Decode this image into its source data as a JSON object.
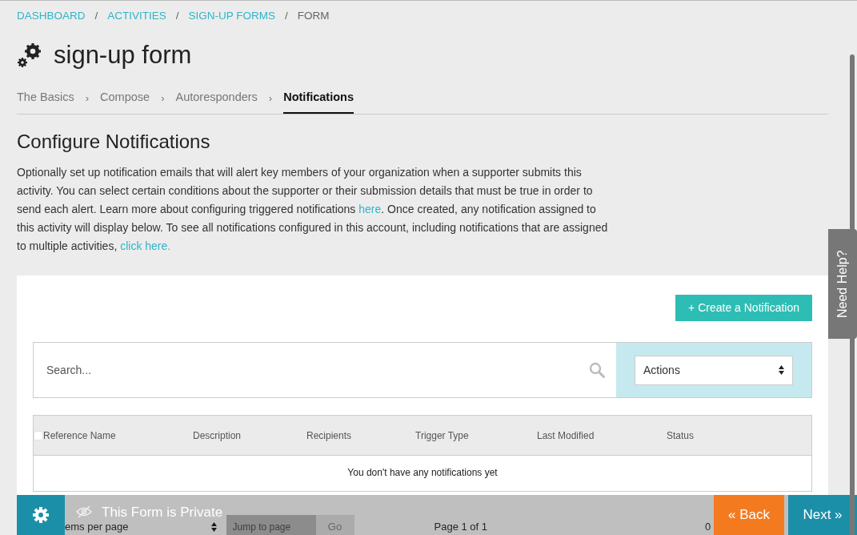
{
  "breadcrumbs": [
    {
      "label": "DASHBOARD",
      "kind": "link"
    },
    {
      "label": "ACTIVITIES",
      "kind": "link"
    },
    {
      "label": "SIGN-UP FORMS",
      "kind": "link"
    },
    {
      "label": "FORM",
      "kind": "current"
    }
  ],
  "breadcrumb_separators": [
    "/",
    "/",
    "/"
  ],
  "title": "sign-up form",
  "step_separators": [
    "›",
    "›",
    "›"
  ],
  "steps": [
    {
      "label": "The Basics",
      "selected": false
    },
    {
      "label": "Compose",
      "selected": false
    },
    {
      "label": "Autoresponders",
      "selected": false
    },
    {
      "label": "Notifications",
      "selected": true
    }
  ],
  "section_title": "Configure Notifications",
  "description": [
    {
      "kind": "text",
      "text": "Optionally set up notification emails that will alert key members of your organization when a supporter submits this activity. You can select certain conditions about the supporter or their submission details that must be true in order to send each alert. Learn more about configuring triggered notifications "
    },
    {
      "kind": "link",
      "text": "here"
    },
    {
      "kind": "text",
      "text": ". Once created, any notification assigned to this activity will display below. To see all notifications configured in this account, including notifications that are assigned to multiple activities, "
    },
    {
      "kind": "link",
      "text": "click here."
    }
  ],
  "create_button": "+ Create a Notification",
  "search": {
    "placeholder": "Search..."
  },
  "actions_select": "Actions",
  "table": {
    "select_all_checked": false,
    "columns": [
      "Reference Name",
      "Description",
      "Recipients",
      "Trigger Type",
      "Last Modified",
      "Status"
    ],
    "empty_message": "You don't have any notifications yet"
  },
  "pagination": {
    "items_per_page_label": "ems per page",
    "jump_placeholder": "Jump to page",
    "go_button": "Go",
    "page_info": "Page 1 of 1",
    "column_5": "0"
  },
  "footer": {
    "privacy": "This Form is Private",
    "back_button": "« Back",
    "next_button": "Next »"
  },
  "help_tab": "Need Help?"
}
